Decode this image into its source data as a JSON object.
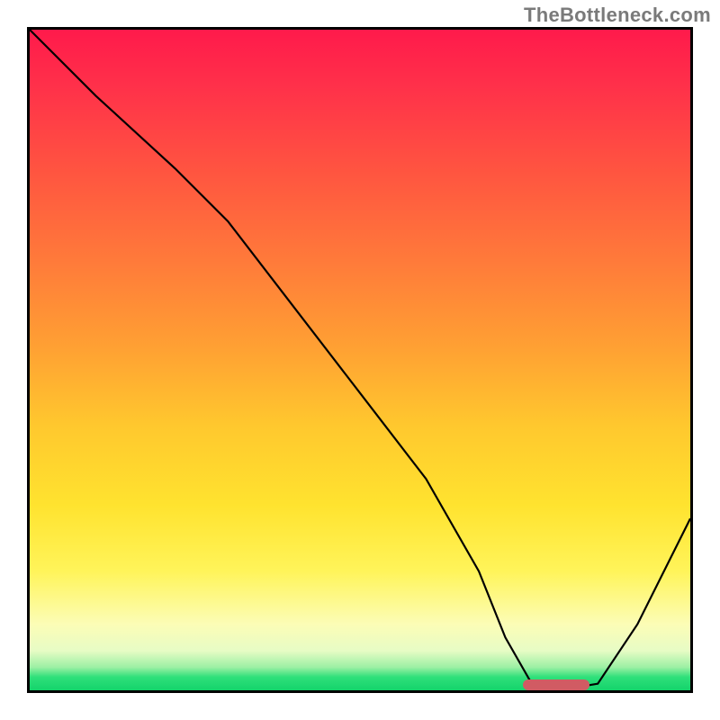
{
  "watermark": "TheBottleneck.com",
  "chart_data": {
    "type": "line",
    "title": "",
    "xlabel": "",
    "ylabel": "",
    "xlim": [
      0,
      100
    ],
    "ylim": [
      0,
      100
    ],
    "grid": false,
    "legend": null,
    "series": [
      {
        "name": "bottleneck-curve",
        "x": [
          0,
          10,
          22,
          30,
          40,
          50,
          60,
          68,
          72,
          76,
          80,
          86,
          92,
          100
        ],
        "y": [
          100,
          90,
          79,
          71,
          58,
          45,
          32,
          18,
          8,
          1,
          0,
          1,
          10,
          26
        ]
      }
    ],
    "annotations": [
      {
        "name": "optimal-range-marker",
        "x_start": 74,
        "x_end": 84,
        "y": 0
      }
    ],
    "background_gradient": {
      "stops": [
        {
          "pos": 0.0,
          "color": "#ff1a4b"
        },
        {
          "pos": 0.35,
          "color": "#ff7a3a"
        },
        {
          "pos": 0.72,
          "color": "#ffe32f"
        },
        {
          "pos": 0.92,
          "color": "#fcfdb6"
        },
        {
          "pos": 1.0,
          "color": "#14d36b"
        }
      ]
    }
  }
}
